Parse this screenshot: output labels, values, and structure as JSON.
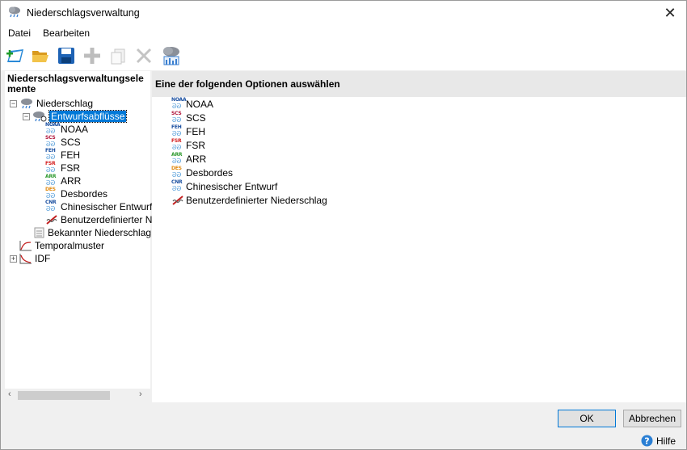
{
  "window": {
    "title": "Niederschlagsverwaltung",
    "close_glyph": "✕"
  },
  "menu": [
    {
      "label": "Datei"
    },
    {
      "label": "Bearbeiten"
    }
  ],
  "left": {
    "header": "Niederschlagsverwaltungsele mente",
    "header_line1": "Niederschlagsverwaltungsele",
    "header_line2": "mente",
    "tree": {
      "root": "Niederschlag",
      "design": "Entwurfsabflüsse",
      "design_children": [
        "NOAA",
        "SCS",
        "FEH",
        "FSR",
        "ARR",
        "Desbordes",
        "Chinesischer Entwurf",
        "Benutzerdefinierter Nie"
      ],
      "known": "Bekannter Niederschlag",
      "temporal": "Temporalmuster",
      "idf": "IDF"
    }
  },
  "right": {
    "header": "Eine der folgenden Optionen auswählen",
    "options": [
      "NOAA",
      "SCS",
      "FEH",
      "FSR",
      "ARR",
      "Desbordes",
      "Chinesischer Entwurf",
      "Benutzerdefinierter Niederschlag"
    ]
  },
  "icon_codes": {
    "NOAA": {
      "code": "NOAA",
      "color": "#1a4fa0"
    },
    "SCS": {
      "code": "SCS",
      "color": "#b0143a"
    },
    "FEH": {
      "code": "FEH",
      "color": "#1a4fa0"
    },
    "FSR": {
      "code": "FSR",
      "color": "#d42020"
    },
    "ARR": {
      "code": "ARR",
      "color": "#2e9a2e"
    },
    "Desbordes": {
      "code": "DES",
      "color": "#e08a10"
    },
    "Chinesischer Entwurf": {
      "code": "CNR",
      "color": "#1a4fa0"
    }
  },
  "buttons": {
    "ok": "OK",
    "cancel": "Abbrechen",
    "help": "Hilfe"
  },
  "colors": {
    "selection": "#0078d7",
    "header_bg": "#e8e8e8"
  }
}
